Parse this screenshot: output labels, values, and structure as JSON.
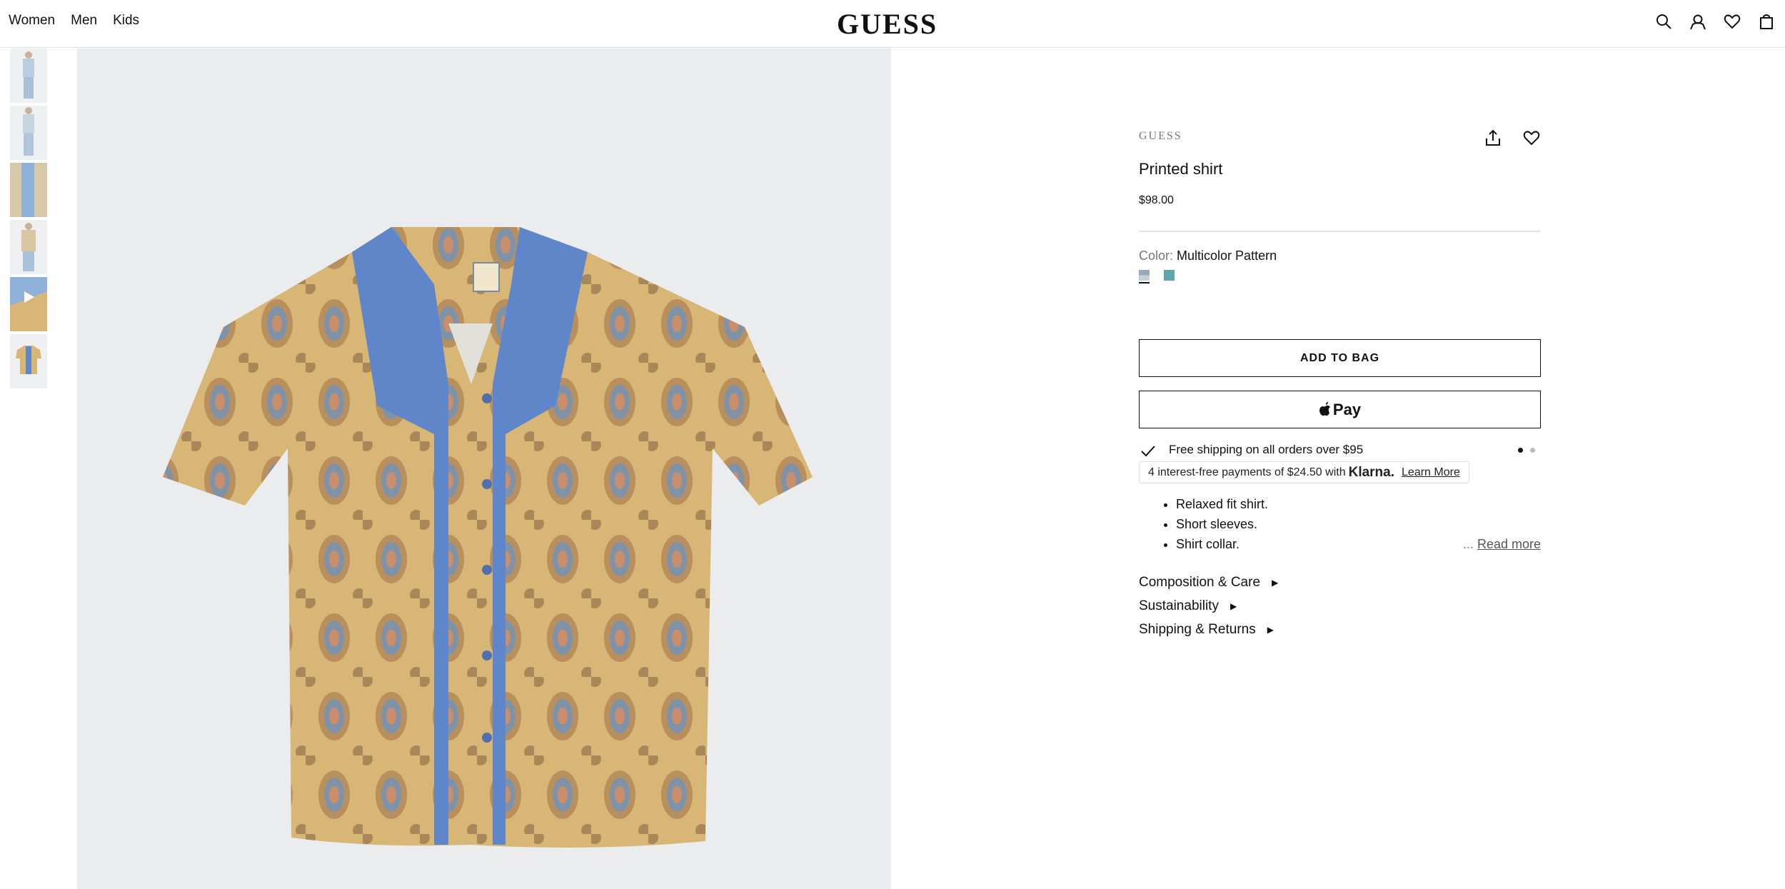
{
  "header": {
    "nav": [
      {
        "label": "Women"
      },
      {
        "label": "Men"
      },
      {
        "label": "Kids"
      }
    ],
    "logo": "GUESS",
    "icons": [
      "search-icon",
      "account-icon",
      "wishlist-icon",
      "bag-icon"
    ]
  },
  "gallery": {
    "thumbnail_count": 6,
    "colors": {
      "shirt_blue": "#5f86c9",
      "shirt_gold": "#d7b676",
      "background": "#ebecee"
    }
  },
  "product": {
    "brand": "GUESS",
    "title": "Printed shirt",
    "price": "$98.00",
    "color_label": "Color:",
    "color_value": "Multicolor Pattern",
    "swatches": [
      {
        "name": "Multicolor Pattern",
        "color": "#9aa9b6",
        "selected": true
      },
      {
        "name": "Teal",
        "color": "#5ea6aa",
        "selected": false
      }
    ],
    "add_to_bag": "ADD TO BAG",
    "apple_pay": "Pay",
    "promo": "Free shipping on all orders over $95",
    "klarna": {
      "text": "4 interest-free payments of $24.50 with",
      "brand": "Klarna.",
      "link": "Learn More"
    },
    "bullets": [
      "Relaxed fit shirt.",
      "Short sleeves.",
      "Shirt collar."
    ],
    "read_more_ellipsis": "...",
    "read_more": "Read more",
    "accordions": [
      {
        "label": "Composition & Care"
      },
      {
        "label": "Sustainability"
      },
      {
        "label": "Shipping & Returns"
      }
    ]
  }
}
